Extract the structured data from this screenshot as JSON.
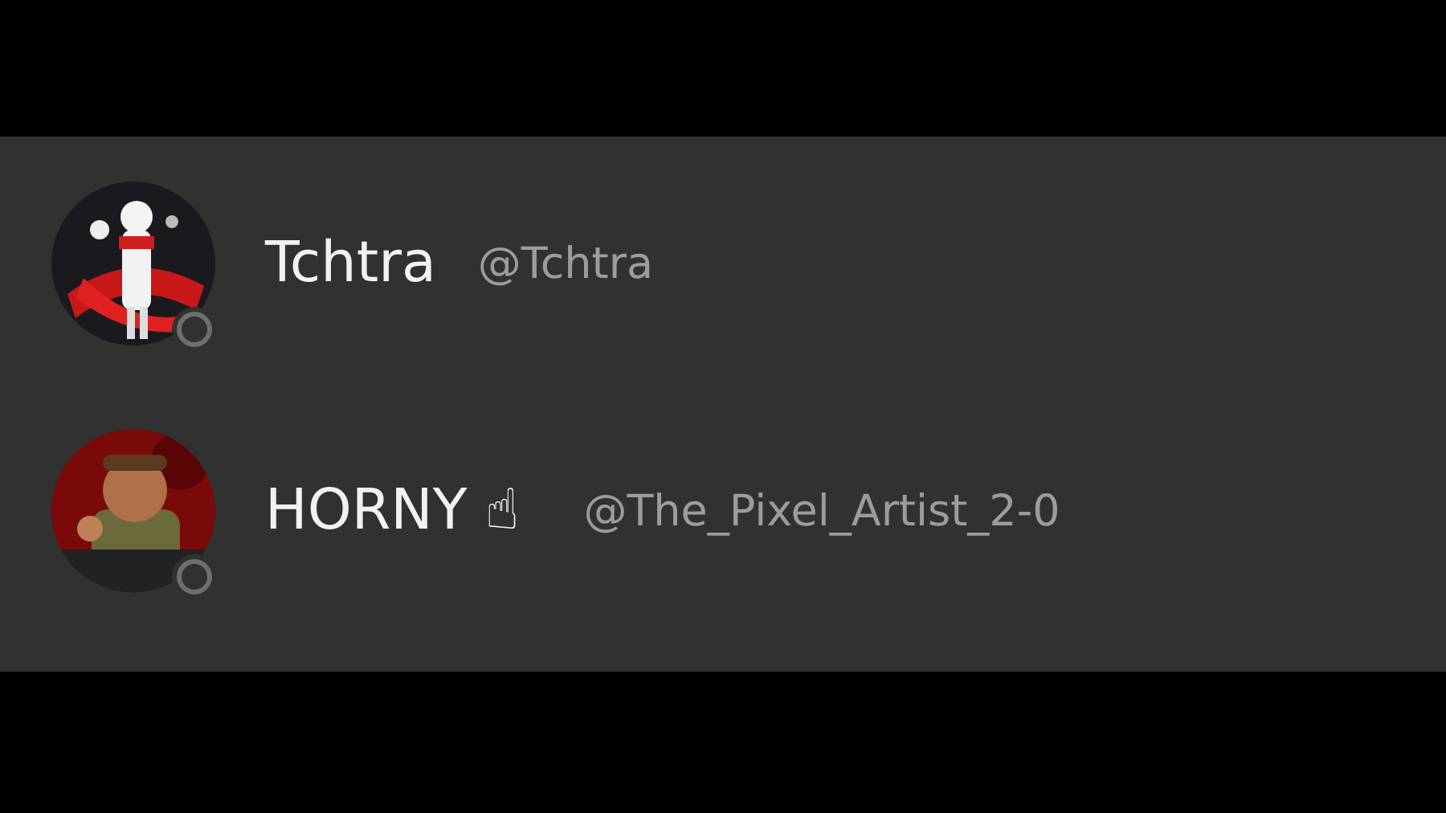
{
  "users": [
    {
      "name": "Tchtra",
      "handle": "@Tchtra",
      "online": false
    },
    {
      "name": "HORNY ☝",
      "handle": "@The_Pixel_Artist_2-0",
      "online": false
    }
  ]
}
